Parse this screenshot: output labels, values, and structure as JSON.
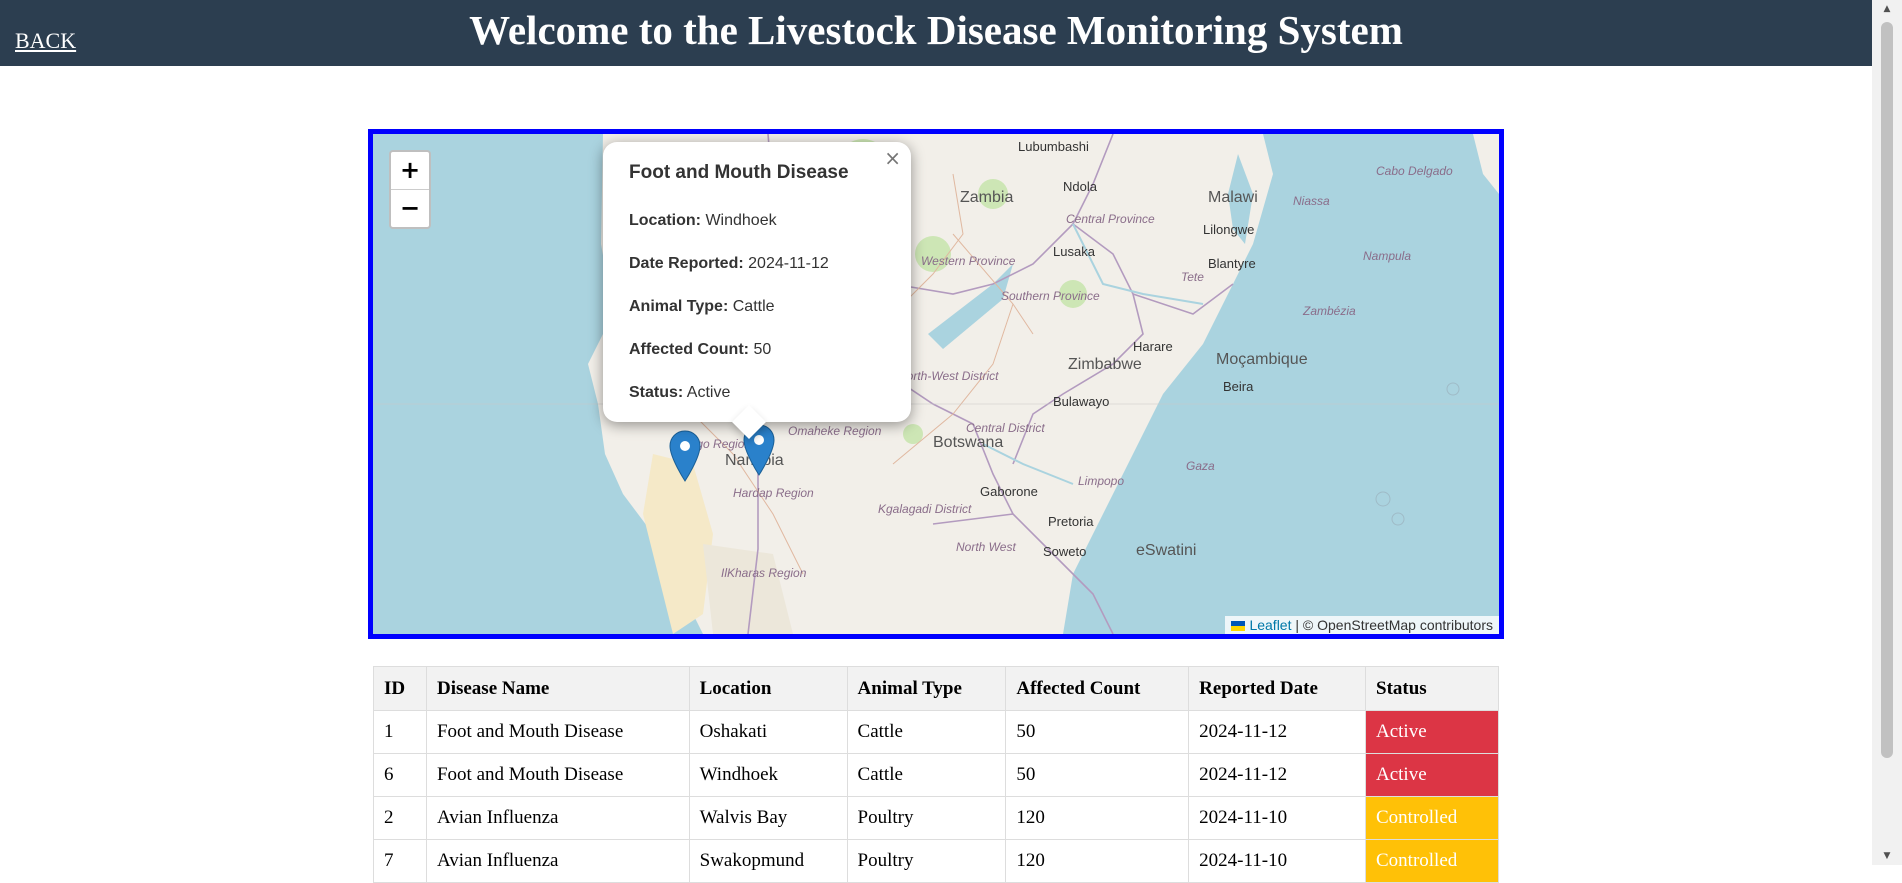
{
  "header": {
    "back_label": "BACK",
    "title": "Welcome to the Livestock Disease Monitoring System"
  },
  "map": {
    "zoom_in": "+",
    "zoom_out": "−",
    "popup": {
      "title": "Foot and Mouth Disease",
      "close": "×",
      "fields": [
        {
          "label": "Location:",
          "value": "Windhoek"
        },
        {
          "label": "Date Reported:",
          "value": "2024-11-12"
        },
        {
          "label": "Animal Type:",
          "value": "Cattle"
        },
        {
          "label": "Affected Count:",
          "value": "50"
        },
        {
          "label": "Status:",
          "value": "Active"
        }
      ]
    },
    "labels": {
      "lubumbashi": "Lubumbashi",
      "zambia": "Zambia",
      "ndola": "Ndola",
      "central_province": "Central Province",
      "malawi": "Malawi",
      "niassa": "Niassa",
      "cabo_delgado": "Cabo Delgado",
      "lilongwe": "Lilongwe",
      "lusaka": "Lusaka",
      "western_province": "Western Province",
      "southern_province": "Southern Province",
      "tete": "Tete",
      "blantyre": "Blantyre",
      "nampula": "Nampula",
      "zambezia": "Zambézia",
      "harare": "Harare",
      "mozambique": "Moçambique",
      "zimbabwe": "Zimbabwe",
      "beira": "Beira",
      "north_west_district": "North-West District",
      "bulawayo": "Bulawayo",
      "central_district": "Central District",
      "omaheke_region": "Omaheke Region",
      "erongo_region": "Erongo Region",
      "namibia": "Namibia",
      "botswana": "Botswana",
      "hardap_region": "Hardap Region",
      "gaborone": "Gaborone",
      "limpopo": "Limpopo",
      "gaza": "Gaza",
      "kgalagadi_district": "Kgalagadi District",
      "pretoria": "Pretoria",
      "north_west": "North West",
      "soweto": "Soweto",
      "eswatini": "eSwatini",
      "ilkharas_region": "IlKharas Region"
    },
    "attribution": {
      "leaflet": "Leaflet",
      "rest": " | © OpenStreetMap contributors"
    }
  },
  "table": {
    "headers": [
      "ID",
      "Disease Name",
      "Location",
      "Animal Type",
      "Affected Count",
      "Reported Date",
      "Status"
    ],
    "rows": [
      {
        "id": "1",
        "disease": "Foot and Mouth Disease",
        "location": "Oshakati",
        "animal": "Cattle",
        "count": "50",
        "date": "2024-11-12",
        "status": "Active"
      },
      {
        "id": "6",
        "disease": "Foot and Mouth Disease",
        "location": "Windhoek",
        "animal": "Cattle",
        "count": "50",
        "date": "2024-11-12",
        "status": "Active"
      },
      {
        "id": "2",
        "disease": "Avian Influenza",
        "location": "Walvis Bay",
        "animal": "Poultry",
        "count": "120",
        "date": "2024-11-10",
        "status": "Controlled"
      },
      {
        "id": "7",
        "disease": "Avian Influenza",
        "location": "Swakopmund",
        "animal": "Poultry",
        "count": "120",
        "date": "2024-11-10",
        "status": "Controlled"
      }
    ]
  },
  "colors": {
    "header_bg": "#2c3e50",
    "map_border": "#0000ff",
    "status_active": "#dc3545",
    "status_controlled": "#ffc107",
    "marker": "#2a81cb"
  }
}
